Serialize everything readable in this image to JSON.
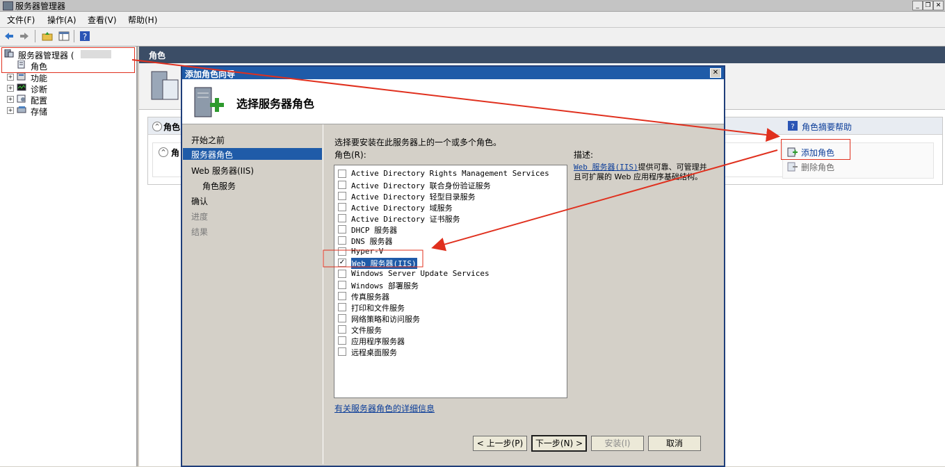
{
  "window": {
    "title": "服务器管理器"
  },
  "menu": [
    "文件(F)",
    "操作(A)",
    "查看(V)",
    "帮助(H)"
  ],
  "tree": {
    "root": "服务器管理器 (",
    "items": [
      "角色",
      "功能",
      "诊断",
      "配置",
      "存储"
    ]
  },
  "main": {
    "header": "角色",
    "section_label": "角色",
    "subsection_label": "角",
    "help_link": "角色摘要帮助",
    "add_role": "添加角色",
    "remove_role": "删除角色"
  },
  "dialog": {
    "title": "添加角色向导",
    "heading": "选择服务器角色",
    "steps": [
      "开始之前",
      "服务器角色",
      "Web 服务器(IIS)",
      "角色服务",
      "确认",
      "进度",
      "结果"
    ],
    "instruction": "选择要安装在此服务器上的一个或多个角色。",
    "roles_label": "角色(R):",
    "roles": [
      {
        "label": "Active Directory Rights Management Services",
        "checked": false
      },
      {
        "label": "Active Directory 联合身份验证服务",
        "checked": false
      },
      {
        "label": "Active Directory 轻型目录服务",
        "checked": false
      },
      {
        "label": "Active Directory 域服务",
        "checked": false
      },
      {
        "label": "Active Directory 证书服务",
        "checked": false
      },
      {
        "label": "DHCP 服务器",
        "checked": false
      },
      {
        "label": "DNS 服务器",
        "checked": false
      },
      {
        "label": "Hyper-V",
        "checked": false
      },
      {
        "label": "Web 服务器(IIS)",
        "checked": true
      },
      {
        "label": "Windows Server Update Services",
        "checked": false
      },
      {
        "label": "Windows 部署服务",
        "checked": false
      },
      {
        "label": "传真服务器",
        "checked": false
      },
      {
        "label": "打印和文件服务",
        "checked": false
      },
      {
        "label": "网络策略和访问服务",
        "checked": false
      },
      {
        "label": "文件服务",
        "checked": false
      },
      {
        "label": "应用程序服务器",
        "checked": false
      },
      {
        "label": "远程桌面服务",
        "checked": false
      }
    ],
    "description_label": "描述:",
    "description_link": "Web 服务器(IIS)",
    "description_text": "提供可靠、可管理并且可扩展的 Web 应用程序基础结构。",
    "more_info_link": "有关服务器角色的详细信息",
    "buttons": {
      "prev": "< 上一步(P)",
      "next": "下一步(N) >",
      "install": "安装(I)",
      "cancel": "取消"
    }
  },
  "colors": {
    "annotation_red": "#e0301e",
    "title_blue": "#1f5ba8",
    "header_dark": "#3b4d66"
  }
}
